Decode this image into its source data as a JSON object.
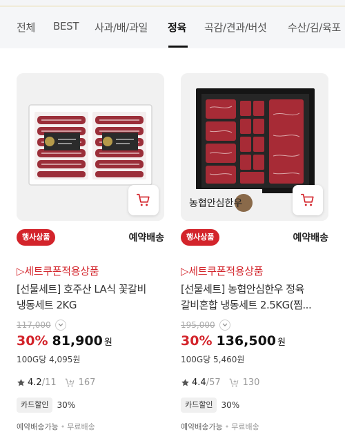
{
  "tabs": [
    "전체",
    "BEST",
    "사과/배/과일",
    "정육",
    "곡감/견과/버섯",
    "수산/김/육포"
  ],
  "active_tab": "정육",
  "products": [
    {
      "badge": "행사상품",
      "delivery": "예약배송",
      "coupon": "▷세트쿠폰적용상품",
      "title_line1": "[선물세트] 호주산 LA식 꽃갈비",
      "title_line2": "냉동세트 2KG",
      "original_price": "117,000",
      "discount": "30%",
      "price": "81,900",
      "won": "원",
      "unit_price": "100G당 4,095원",
      "rating": "4.2",
      "reviews": "11",
      "cart_count": "167",
      "card_discount_label": "카드할인",
      "card_discount": "30%",
      "shipping": "예약배송가능",
      "free_shipping": "무료배송"
    },
    {
      "badge": "행사상품",
      "delivery": "예약배송",
      "coupon": "▷세트쿠폰적용상품",
      "title_line1": "[선물세트] 농협안심한우 정육",
      "title_line2": "갈비혼합 냉동세트 2.5KG(찜...",
      "original_price": "195,000",
      "discount": "30%",
      "price": "136,500",
      "won": "원",
      "unit_price": "100G당 5,460원",
      "rating": "4.4",
      "reviews": "57",
      "cart_count": "130",
      "card_discount_label": "카드할인",
      "card_discount": "30%",
      "shipping": "예약배송가능",
      "free_shipping": "무료배송",
      "brand_logo": "농협안심한우"
    }
  ],
  "colors": {
    "accent": "#d3242b",
    "tab_bg": "#f5f6f8"
  }
}
